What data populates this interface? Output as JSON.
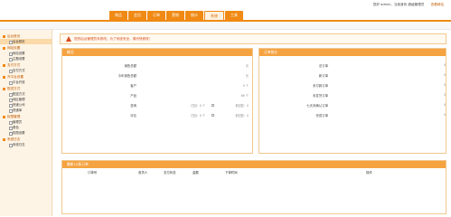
{
  "nav": {
    "items": [
      {
        "label": "商品"
      },
      {
        "label": "会员"
      },
      {
        "label": "订单"
      },
      {
        "label": "营销"
      },
      {
        "label": "统计"
      },
      {
        "label": "系统"
      },
      {
        "label": "工具"
      }
    ],
    "active_index": 5
  },
  "top_right": {
    "greeting": "您好 admin，当前身份 超级管理员",
    "link": "查看网站"
  },
  "sidebar": {
    "groups": [
      {
        "title": "后台首页",
        "items": [
          "后台首页"
        ]
      },
      {
        "title": "网站设置",
        "items": [
          "网站设置",
          "主题设置"
        ]
      },
      {
        "title": "支付方式",
        "items": [
          "支付方式"
        ]
      },
      {
        "title": "开平台设置",
        "items": [
          "平台开放"
        ]
      },
      {
        "title": "配送方式",
        "items": [
          "配送方式",
          "地区管理",
          "快递公司",
          "快递单"
        ]
      },
      {
        "title": "权限管理",
        "items": [
          "管理员",
          "角色",
          "权限设置"
        ]
      },
      {
        "title": "系统日志",
        "items": [
          "系统日志"
        ]
      }
    ]
  },
  "alert": {
    "text": "您的后台管理员未修改，为了系统安全，请尽快修改！"
  },
  "overview": {
    "title": "概况",
    "rows": [
      {
        "label": "销售总额",
        "value": "元"
      },
      {
        "label": "今年销售总额",
        "value": "元"
      },
      {
        "label": "客户",
        "value": "0 个"
      },
      {
        "label": "产品",
        "value": "69 个"
      },
      {
        "label": "咨询",
        "extra": "已回：0 个",
        "value": "未回复：0"
      },
      {
        "label": "评论",
        "extra": "已回：0 个",
        "value": "未回复：0"
      }
    ]
  },
  "order_stats": {
    "title": "订单统计",
    "rows": [
      {
        "label": "总订单",
        "value": "0"
      },
      {
        "label": "新订单",
        "value": "0"
      },
      {
        "label": "未付款订单",
        "value": "0"
      },
      {
        "label": "未发货订单",
        "value": "0"
      },
      {
        "label": "七天未确认订单",
        "value": "0"
      },
      {
        "label": "完成订单",
        "value": "0"
      }
    ]
  },
  "latest_orders": {
    "title": "最新10条订单",
    "columns": [
      "订单号",
      "收货人",
      "支付状态",
      "金额",
      "下单时间",
      "操作"
    ]
  },
  "colors": {
    "accent": "#f08a14",
    "panel_head": "#f5a340",
    "sidebar_bg": "#fdf4e6",
    "alert": "#d94a1a"
  }
}
